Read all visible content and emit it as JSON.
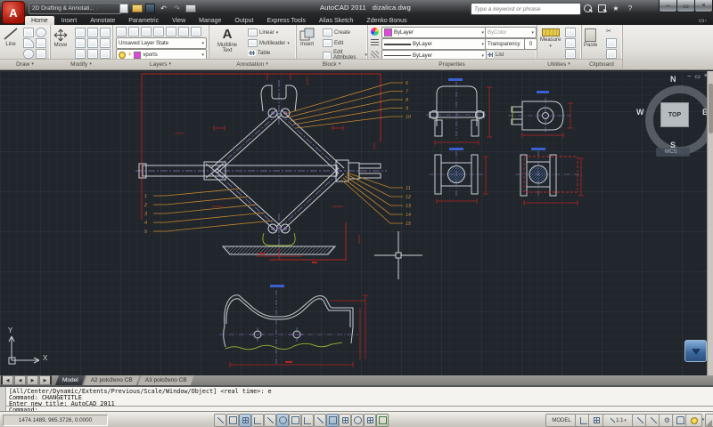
{
  "icons": {
    "dropdown": "▾",
    "minimize": "–",
    "restore": "▭",
    "close": "×",
    "undo": "↶",
    "redo": "↷",
    "star": "★",
    "help": "?",
    "sun": "☀",
    "prev": "◀",
    "next": "▶",
    "scissors": "✂",
    "gear": "⚙"
  },
  "titlebar": {
    "workspace": "2D Drafting & Annotati...",
    "app_title": "AutoCAD 2011",
    "doc_title": "dizalica.dwg",
    "search_placeholder": "Type a keyword or phrase"
  },
  "ribbon": {
    "tabs": [
      {
        "label": "Home"
      },
      {
        "label": "Insert"
      },
      {
        "label": "Annotate"
      },
      {
        "label": "Parametric"
      },
      {
        "label": "View"
      },
      {
        "label": "Manage"
      },
      {
        "label": "Output"
      },
      {
        "label": "Express Tools"
      },
      {
        "label": "Alias Sketch"
      },
      {
        "label": "Zdenko Bonus"
      }
    ],
    "panels": {
      "draw": {
        "title": "Draw",
        "line": "Line"
      },
      "modify": {
        "title": "Modify",
        "move": "Move"
      },
      "layers": {
        "title": "Layers",
        "layer_state": "Unsaved Layer State",
        "current_layer": "vports"
      },
      "annotation": {
        "title": "Annotation",
        "big_a": "A",
        "multiline_text": "Multiline Text",
        "linear": "Linear",
        "multileader": "Multileader",
        "table": "Table"
      },
      "block": {
        "title": "Block",
        "insert": "Insert",
        "create": "Create",
        "edit": "Edit",
        "edit_attributes": "Edit Attributes"
      },
      "properties": {
        "title": "Properties",
        "object_color": "ByLayer",
        "lineweight": "ByLayer",
        "linetype": "ByLayer",
        "plot_style": "ByColor",
        "transparency_label": "Transparency",
        "transparency_value": "0",
        "list": "List"
      },
      "utilities": {
        "title": "Utilities",
        "measure": "Measure"
      },
      "clipboard": {
        "title": "Clipboard",
        "paste": "Paste"
      }
    }
  },
  "canvas": {
    "viewcube": {
      "n": "N",
      "s": "S",
      "e": "E",
      "w": "W",
      "face": "TOP",
      "wcs": "WCS"
    },
    "ucs": {
      "x": "X",
      "y": "Y"
    },
    "balloons_left": [
      "1",
      "2",
      "3",
      "4",
      "5"
    ],
    "balloons_top_right": [
      "6",
      "7",
      "8",
      "9",
      "10"
    ],
    "balloons_right": [
      "11",
      "12",
      "13",
      "14",
      "15"
    ]
  },
  "layout_tabs": {
    "model": "Model",
    "tab2": "A2 položeno CB",
    "tab3": "A3 položeno CB"
  },
  "command": {
    "history": [
      "[All/Center/Dynamic/Extents/Previous/Scale/Window/Object] <real time>: e",
      "Command: CHANGETITLE",
      "Enter new title: AutoCAD 2011"
    ],
    "prompt": "Command:"
  },
  "statusbar": {
    "coords": "1474.1489, 965.3726, 0.0000",
    "model_label": "MODEL",
    "annotation_scale": "1:1"
  }
}
